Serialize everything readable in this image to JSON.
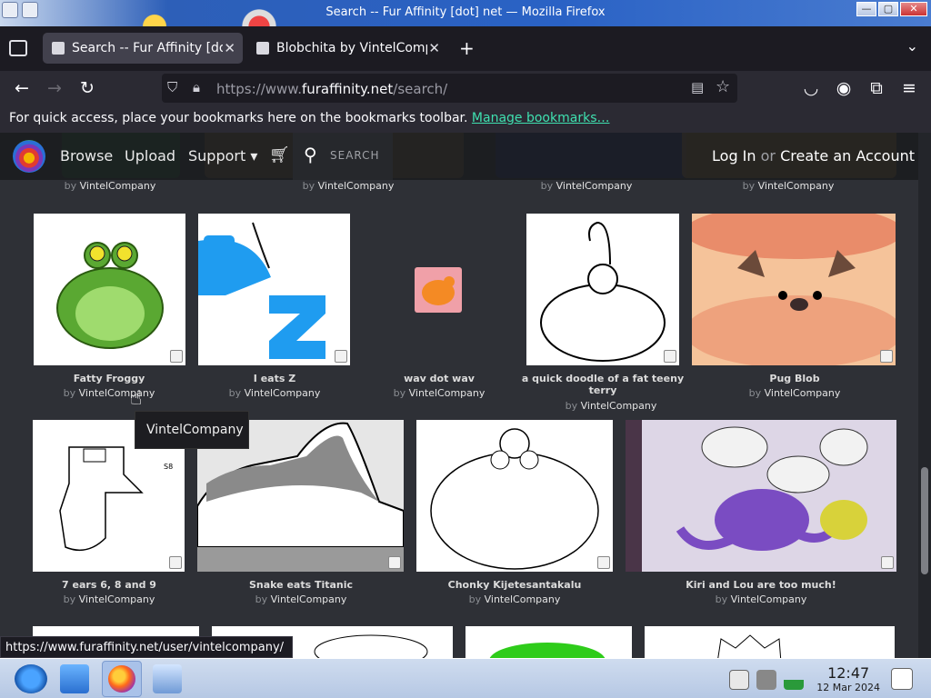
{
  "window": {
    "title": "Search -- Fur Affinity [dot] net — Mozilla Firefox",
    "min_label": "—",
    "max_label": "▢",
    "close_label": "✕"
  },
  "tabs": [
    {
      "label": "Search -- Fur Affinity [dot] net",
      "active": true
    },
    {
      "label": "Blobchita by VintelCompany",
      "active": false
    }
  ],
  "tab_controls": {
    "new_tab": "+",
    "list_all": "⌄",
    "close": "✕"
  },
  "nav": {
    "back": "←",
    "forward": "→",
    "reload": "↻",
    "url_prefix": "https://www.",
    "url_host": "furaffinity.net",
    "url_path": "/search/",
    "reader_icon": "▤",
    "bookmark_star": "☆",
    "pocket_icon": "◡",
    "account_icon": "◉",
    "extensions_icon": "⧉",
    "menu_icon": "≡"
  },
  "bookmarks": {
    "text": "For quick access, place your bookmarks here on the bookmarks toolbar.",
    "link": "Manage bookmarks…"
  },
  "site": {
    "nav": [
      "Browse",
      "Upload",
      "Support ▾"
    ],
    "search_label": "SEARCH",
    "login": "Log In",
    "or": "or",
    "create": "Create an Account"
  },
  "top_bylines": [
    "VintelCompany",
    "VintelCompany",
    "VintelCompany",
    "VintelCompany"
  ],
  "by_word": "by",
  "row1": [
    {
      "title": "Fatty Froggy",
      "author": "VintelCompany"
    },
    {
      "title": "I eats Z",
      "author": "VintelCompany"
    },
    {
      "title": "wav dot wav",
      "author": "VintelCompany"
    },
    {
      "title": "a quick doodle of a fat teeny terry",
      "author": "VintelCompany"
    },
    {
      "title": "Pug Blob",
      "author": "VintelCompany"
    }
  ],
  "row2": [
    {
      "title": "7 ears 6, 8 and 9",
      "author": "VintelCompany"
    },
    {
      "title": "Snake eats Titanic",
      "author": "VintelCompany"
    },
    {
      "title": "Chonky Kijetesantakalu",
      "author": "VintelCompany"
    },
    {
      "title": "Kiri and Lou are too much!",
      "author": "VintelCompany"
    }
  ],
  "tooltip": "VintelCompany",
  "status_url": "https://www.furaffinity.net/user/vintelcompany/",
  "clock": {
    "time": "12:47",
    "date": "12 Mar 2024"
  },
  "colors": {
    "accent_link": "#3fe1b0",
    "page_bg": "#2e3036"
  }
}
